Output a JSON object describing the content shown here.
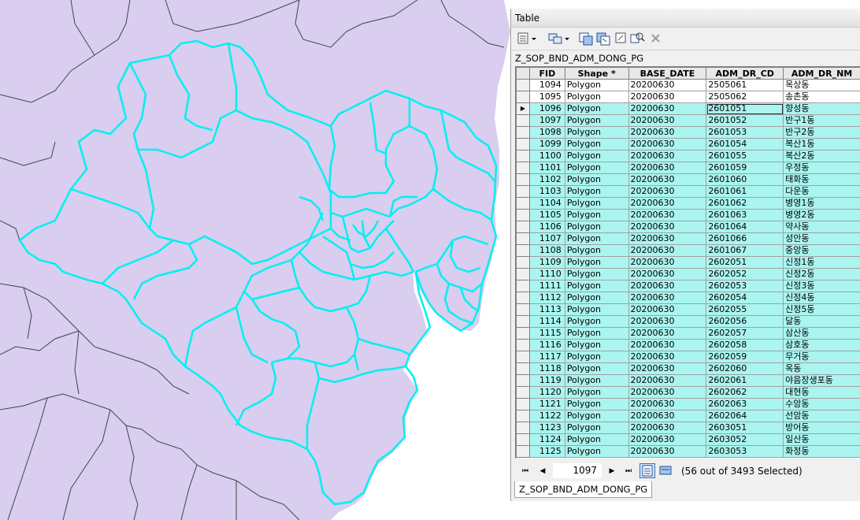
{
  "map": {
    "background": "#d9cdf0",
    "highlight_color": "#00f0f0",
    "boundary_color": "#444444"
  },
  "table_window": {
    "title": "Table",
    "layer_name": "Z_SOP_BND_ADM_DONG_PG",
    "tab_label": "Z_SOP_BND_ADM_DONG_PG",
    "toolbar_icons": [
      "table-options-icon",
      "related-tables-icon",
      "select-by-attributes-icon",
      "switch-selection-icon",
      "clear-selection-icon",
      "zoom-to-selected-icon",
      "delete-selected-icon"
    ],
    "columns": [
      "FID",
      "Shape *",
      "BASE_DATE",
      "ADM_DR_CD",
      "ADM_DR_NM"
    ],
    "rows": [
      {
        "fid": "1094",
        "shape": "Polygon",
        "date": "20200630",
        "code": "2505061",
        "name": "목상동",
        "selected": false
      },
      {
        "fid": "1095",
        "shape": "Polygon",
        "date": "20200630",
        "code": "2505062",
        "name": "송촌동",
        "selected": false
      },
      {
        "fid": "1096",
        "shape": "Polygon",
        "date": "20200630",
        "code": "2601051",
        "name": "향성동",
        "selected": true,
        "current": true
      },
      {
        "fid": "1097",
        "shape": "Polygon",
        "date": "20200630",
        "code": "2601052",
        "name": "반구1동",
        "selected": true
      },
      {
        "fid": "1098",
        "shape": "Polygon",
        "date": "20200630",
        "code": "2601053",
        "name": "반구2동",
        "selected": true
      },
      {
        "fid": "1099",
        "shape": "Polygon",
        "date": "20200630",
        "code": "2601054",
        "name": "복산1동",
        "selected": true
      },
      {
        "fid": "1100",
        "shape": "Polygon",
        "date": "20200630",
        "code": "2601055",
        "name": "복산2동",
        "selected": true
      },
      {
        "fid": "1101",
        "shape": "Polygon",
        "date": "20200630",
        "code": "2601059",
        "name": "우정동",
        "selected": true
      },
      {
        "fid": "1102",
        "shape": "Polygon",
        "date": "20200630",
        "code": "2601060",
        "name": "태화동",
        "selected": true
      },
      {
        "fid": "1103",
        "shape": "Polygon",
        "date": "20200630",
        "code": "2601061",
        "name": "다운동",
        "selected": true
      },
      {
        "fid": "1104",
        "shape": "Polygon",
        "date": "20200630",
        "code": "2601062",
        "name": "병영1동",
        "selected": true
      },
      {
        "fid": "1105",
        "shape": "Polygon",
        "date": "20200630",
        "code": "2601063",
        "name": "병영2동",
        "selected": true
      },
      {
        "fid": "1106",
        "shape": "Polygon",
        "date": "20200630",
        "code": "2601064",
        "name": "약사동",
        "selected": true
      },
      {
        "fid": "1107",
        "shape": "Polygon",
        "date": "20200630",
        "code": "2601066",
        "name": "성안동",
        "selected": true
      },
      {
        "fid": "1108",
        "shape": "Polygon",
        "date": "20200630",
        "code": "2601067",
        "name": "중앙동",
        "selected": true
      },
      {
        "fid": "1109",
        "shape": "Polygon",
        "date": "20200630",
        "code": "2602051",
        "name": "신정1동",
        "selected": true
      },
      {
        "fid": "1110",
        "shape": "Polygon",
        "date": "20200630",
        "code": "2602052",
        "name": "신정2동",
        "selected": true
      },
      {
        "fid": "1111",
        "shape": "Polygon",
        "date": "20200630",
        "code": "2602053",
        "name": "신정3동",
        "selected": true
      },
      {
        "fid": "1112",
        "shape": "Polygon",
        "date": "20200630",
        "code": "2602054",
        "name": "신정4동",
        "selected": true
      },
      {
        "fid": "1113",
        "shape": "Polygon",
        "date": "20200630",
        "code": "2602055",
        "name": "신정5동",
        "selected": true
      },
      {
        "fid": "1114",
        "shape": "Polygon",
        "date": "20200630",
        "code": "2602056",
        "name": "달동",
        "selected": true
      },
      {
        "fid": "1115",
        "shape": "Polygon",
        "date": "20200630",
        "code": "2602057",
        "name": "삼산동",
        "selected": true
      },
      {
        "fid": "1116",
        "shape": "Polygon",
        "date": "20200630",
        "code": "2602058",
        "name": "삼호동",
        "selected": true
      },
      {
        "fid": "1117",
        "shape": "Polygon",
        "date": "20200630",
        "code": "2602059",
        "name": "무거동",
        "selected": true
      },
      {
        "fid": "1118",
        "shape": "Polygon",
        "date": "20200630",
        "code": "2602060",
        "name": "옥동",
        "selected": true
      },
      {
        "fid": "1119",
        "shape": "Polygon",
        "date": "20200630",
        "code": "2602061",
        "name": "야음장생포동",
        "selected": true
      },
      {
        "fid": "1120",
        "shape": "Polygon",
        "date": "20200630",
        "code": "2602062",
        "name": "대현동",
        "selected": true
      },
      {
        "fid": "1121",
        "shape": "Polygon",
        "date": "20200630",
        "code": "2602063",
        "name": "수암동",
        "selected": true
      },
      {
        "fid": "1122",
        "shape": "Polygon",
        "date": "20200630",
        "code": "2602064",
        "name": "선암동",
        "selected": true
      },
      {
        "fid": "1123",
        "shape": "Polygon",
        "date": "20200630",
        "code": "2603051",
        "name": "방어동",
        "selected": true
      },
      {
        "fid": "1124",
        "shape": "Polygon",
        "date": "20200630",
        "code": "2603052",
        "name": "일산동",
        "selected": true
      },
      {
        "fid": "1125",
        "shape": "Polygon",
        "date": "20200630",
        "code": "2603053",
        "name": "화정동",
        "selected": true
      }
    ],
    "nav": {
      "current_record": "1097",
      "status": "(56 out of 3493 Selected)"
    }
  }
}
